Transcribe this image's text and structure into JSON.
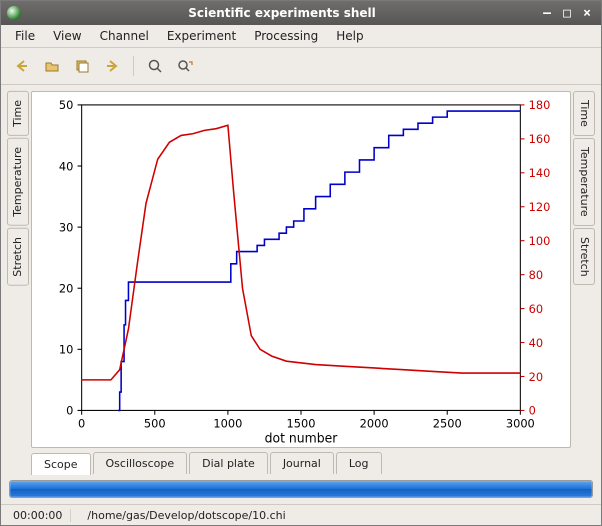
{
  "window": {
    "title": "Scientific experiments shell"
  },
  "menu": {
    "items": [
      "File",
      "View",
      "Channel",
      "Experiment",
      "Processing",
      "Help"
    ]
  },
  "toolbar": {
    "buttons": [
      {
        "name": "back-icon"
      },
      {
        "name": "open-folder-icon"
      },
      {
        "name": "save-copy-icon"
      },
      {
        "name": "forward-icon"
      },
      {
        "sep": true
      },
      {
        "name": "zoom-icon"
      },
      {
        "name": "zoom-select-icon"
      }
    ]
  },
  "side_tabs_left": [
    "Time",
    "Temperature",
    "Stretch"
  ],
  "side_tabs_right": [
    "Time",
    "Temperature",
    "Stretch"
  ],
  "bottom_tabs": [
    "Scope",
    "Oscilloscope",
    "Dial plate",
    "Journal",
    "Log"
  ],
  "bottom_tab_active": 0,
  "progress": {
    "percent": 100
  },
  "status": {
    "time": "00:00:00",
    "path": "/home/gas/Develop/dotscope/10.chi"
  },
  "chart_data": {
    "type": "line",
    "xlabel": "dot number",
    "ylabel_left": "",
    "ylabel_right": "",
    "xlim": [
      0,
      3000
    ],
    "ylim_left": [
      0,
      50
    ],
    "ylim_right": [
      0,
      180
    ],
    "xticks": [
      0,
      500,
      1000,
      1500,
      2000,
      2500,
      3000
    ],
    "yticks_left": [
      0,
      10,
      20,
      30,
      40,
      50
    ],
    "yticks_right": [
      0,
      20,
      40,
      60,
      80,
      100,
      120,
      140,
      160,
      180
    ],
    "series": [
      {
        "name": "blue-step",
        "axis": "left",
        "color": "#0000c8",
        "x": [
          250,
          260,
          270,
          290,
          300,
          320,
          1000,
          1020,
          1060,
          1100,
          1150,
          1200,
          1250,
          1300,
          1350,
          1400,
          1450,
          1520,
          1600,
          1700,
          1800,
          1900,
          2000,
          2100,
          2200,
          2300,
          2400,
          2500,
          2600,
          3000
        ],
        "y": [
          0,
          3,
          8,
          14,
          18,
          21,
          21,
          24,
          26,
          26,
          26,
          27,
          28,
          28,
          29,
          30,
          31,
          33,
          35,
          37,
          39,
          41,
          43,
          45,
          46,
          47,
          48,
          49,
          49,
          49
        ]
      },
      {
        "name": "red-temperature",
        "axis": "right",
        "color": "#d00000",
        "x": [
          0,
          200,
          260,
          320,
          380,
          440,
          520,
          600,
          680,
          760,
          840,
          920,
          1000,
          1040,
          1100,
          1160,
          1220,
          1300,
          1400,
          1600,
          1800,
          2000,
          2200,
          2400,
          2600,
          2800,
          3000
        ],
        "y": [
          18,
          18,
          24,
          48,
          86,
          122,
          148,
          158,
          162,
          163,
          165,
          166,
          168,
          128,
          72,
          44,
          36,
          32,
          29,
          27,
          26,
          25,
          24,
          23,
          22,
          22,
          22
        ]
      }
    ]
  }
}
